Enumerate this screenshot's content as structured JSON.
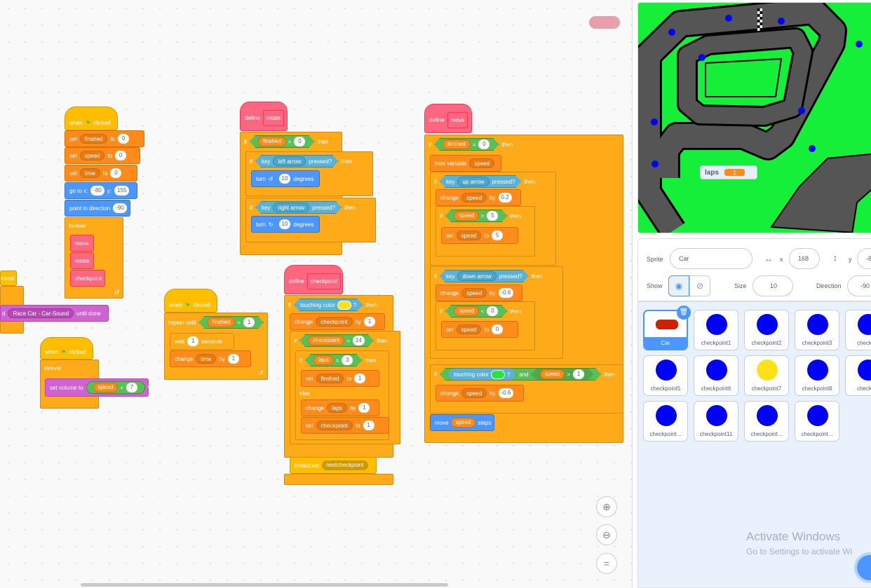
{
  "blocks": {
    "when": "when",
    "clicked": "clicked",
    "set": "set",
    "to": "to",
    "by": "by",
    "change": "change",
    "if": "if",
    "then": "then",
    "else": "else",
    "forever": "forever",
    "turn": "turn",
    "degrees": "degrees",
    "key": "key",
    "pressed": "pressed?",
    "define": "define",
    "and": "and",
    "q": "?",
    "wait": "wait",
    "seconds": "seconds",
    "repeat_until": "repeat until",
    "goto": "go to x:",
    "y": "y:",
    "point_dir": "point in direction",
    "move": "move",
    "steps": "steps",
    "hide_var": "hide variable",
    "broadcast": "broadcast",
    "touching_color": "touching color",
    "set_volume": "set volume to",
    "percent": "%",
    "until_done": "until done",
    "icked": "icked",
    "d": "d",
    "gt": ">",
    "lt": "<",
    "eq": "=",
    "plus": "+",
    "var_finshed": "finshed",
    "var_speed": "speed",
    "var_time": "time",
    "var_laps": "laps",
    "var_checkpoint": "checkpoint",
    "n0": "0",
    "n1": "1",
    "n3": "3",
    "n5": "5",
    "n7": "7",
    "n10": "10",
    "n14": "14",
    "n155": "155",
    "n_80": "-80",
    "n_90": "-90",
    "n02": "0.2",
    "n_06": "-0.6",
    "key_left": "left arrow",
    "key_right": "right arrow",
    "key_up": "up arrow",
    "key_down": "down arrow",
    "proc_move": "move",
    "proc_rotate": "rotate",
    "proc_checkpoint": "checkpoint",
    "sound": "Race Car - Car-Sound",
    "msg": "nextcheckpoint"
  },
  "colors": {
    "touch_yellow": "#ffe11a",
    "touch_green": "#22e63a",
    "stage_bg": "#16ef3a",
    "track": "#555555"
  },
  "stage": {
    "laps_label": "laps",
    "laps_value": "1"
  },
  "sprite_info": {
    "sprite_label": "Sprite",
    "sprite_name": "Car",
    "x_label": "x",
    "x_value": "168",
    "y_label": "y",
    "y_value": "-8",
    "show_label": "Show",
    "size_label": "Size",
    "size_value": "10",
    "direction_label": "Direction",
    "direction_value": "-90"
  },
  "sprites": [
    {
      "name": "Car",
      "color": "#cc2200"
    },
    {
      "name": "checkpoint1",
      "color": "#0000ff"
    },
    {
      "name": "checkpoint2",
      "color": "#0000ff"
    },
    {
      "name": "checkpoint3",
      "color": "#0000ff"
    },
    {
      "name": "checkpo",
      "color": "#0000ff"
    },
    {
      "name": "checkpoint5",
      "color": "#0000ff"
    },
    {
      "name": "checkpoint6",
      "color": "#0000ff"
    },
    {
      "name": "checkpoint7",
      "color": "#ffe11a"
    },
    {
      "name": "checkpoint8",
      "color": "#0000ff"
    },
    {
      "name": "checkpo",
      "color": "#0000ff"
    },
    {
      "name": "checkpoint...",
      "color": "#0000ff"
    },
    {
      "name": "checkpoint11",
      "color": "#0000ff"
    },
    {
      "name": "checkpoint...",
      "color": "#0000ff"
    },
    {
      "name": "checkpoint...",
      "color": "#0000ff"
    }
  ],
  "watermark": {
    "line1": "Activate Windows",
    "line2": "Go to Settings to activate Wi"
  }
}
